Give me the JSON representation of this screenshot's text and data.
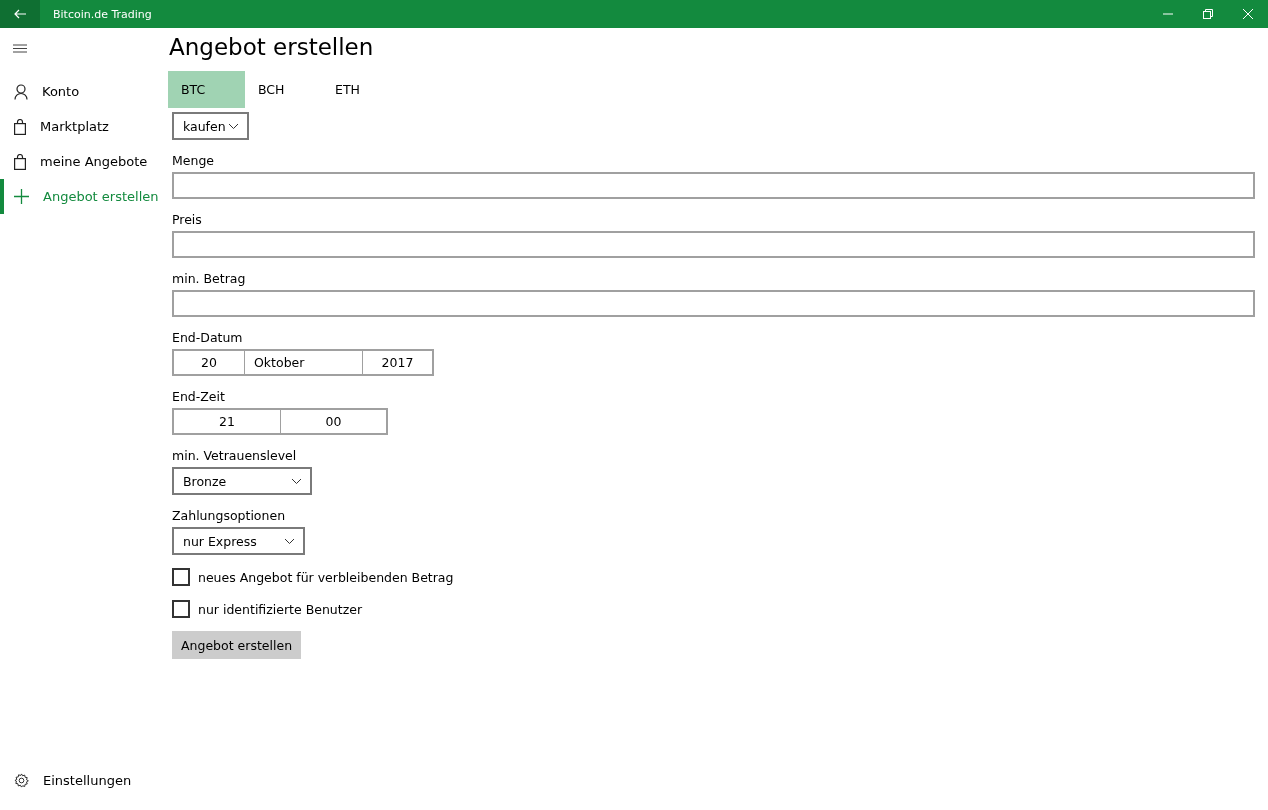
{
  "window": {
    "title": "Bitcoin.de Trading"
  },
  "sidebar": {
    "items": [
      {
        "label": "Konto",
        "kind": "person",
        "selected": false
      },
      {
        "label": "Marktplatz",
        "kind": "bag",
        "selected": false
      },
      {
        "label": "meine Angebote",
        "kind": "bag",
        "selected": false
      },
      {
        "label": "Angebot erstellen",
        "kind": "plus",
        "selected": true
      }
    ],
    "footer": {
      "label": "Einstellungen"
    }
  },
  "page": {
    "title": "Angebot erstellen",
    "tabs": [
      {
        "label": "BTC",
        "selected": true
      },
      {
        "label": "BCH",
        "selected": false
      },
      {
        "label": "ETH",
        "selected": false
      }
    ],
    "direction": {
      "value": "kaufen"
    },
    "fields": [
      {
        "kind": "text",
        "label": "Menge"
      },
      {
        "kind": "text",
        "label": "Preis"
      },
      {
        "kind": "text",
        "label": "min. Betrag"
      },
      {
        "kind": "segments",
        "label": "End-Datum",
        "segments": [
          "20",
          "Oktober",
          "2017"
        ]
      },
      {
        "kind": "segments",
        "label": "End-Zeit",
        "segments": [
          "21",
          "00"
        ]
      },
      {
        "kind": "select",
        "label": "min. Vetrauenslevel",
        "value": "Bronze"
      },
      {
        "kind": "select",
        "label": "Zahlungsoptionen",
        "value": "nur Express"
      }
    ],
    "checkboxes": [
      {
        "label": "neues Angebot für verbleibenden Betrag",
        "checked": false
      },
      {
        "label": "nur identifizierte Benutzer",
        "checked": false
      }
    ],
    "submit": {
      "label": "Angebot erstellen"
    }
  }
}
